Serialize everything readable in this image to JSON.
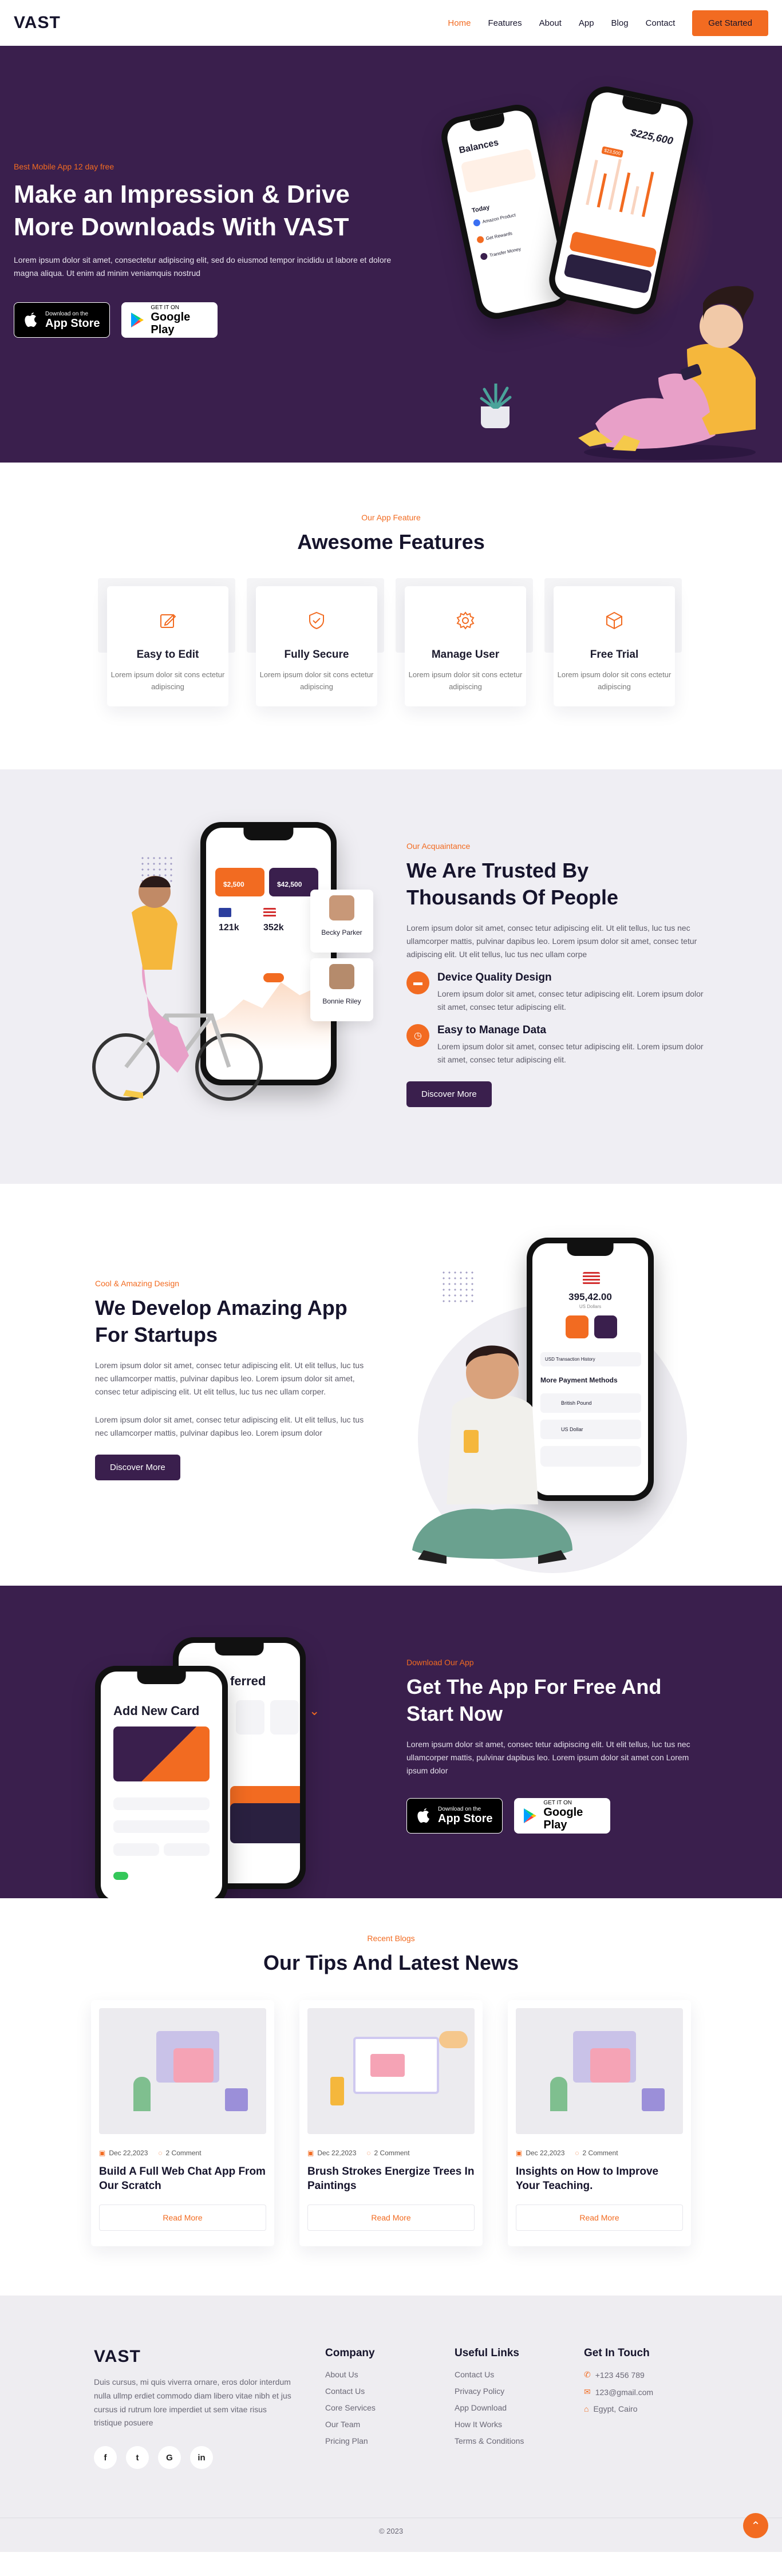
{
  "header": {
    "logo": "VAST",
    "nav": [
      "Home",
      "Features",
      "About",
      "App",
      "Blog",
      "Contact"
    ],
    "cta": "Get Started"
  },
  "hero": {
    "eyebrow": "Best Mobile App 12 day free",
    "title": "Make an Impression & Drive More Downloads With VAST",
    "text": "Lorem ipsum dolor sit amet, consectetur adipiscing elit, sed do eiusmod tempor incididu ut labore et dolore magna aliqua. Ut enim ad minim veniamquis nostrud",
    "phone_left": {
      "title": "Balances",
      "section": "Today",
      "items": [
        "Amazon Product",
        "Get Rewards",
        "Transfer Money"
      ]
    },
    "phone_right": {
      "balance": "$225,600",
      "badge": "$23,500"
    }
  },
  "stores": {
    "apple_small": "Download on the",
    "apple_big": "App Store",
    "google_small": "GET IT ON",
    "google_big": "Google Play"
  },
  "features": {
    "eyebrow": "Our App Feature",
    "title": "Awesome Features",
    "items": [
      {
        "title": "Easy to Edit",
        "text": "Lorem ipsum dolor sit cons ectetur adipiscing",
        "icon": "edit-icon"
      },
      {
        "title": "Fully Secure",
        "text": "Lorem ipsum dolor sit cons ectetur adipiscing",
        "icon": "shield-icon"
      },
      {
        "title": "Manage User",
        "text": "Lorem ipsum dolor sit cons ectetur adipiscing",
        "icon": "gear-icon"
      },
      {
        "title": "Free Trial",
        "text": "Lorem ipsum dolor sit cons ectetur adipiscing",
        "icon": "box-icon"
      }
    ]
  },
  "trusted": {
    "eyebrow": "Our Acquaintance",
    "title": "We Are Trusted By Thousands Of People",
    "text": "Lorem ipsum dolor sit amet, consec tetur adipiscing elit. Ut elit tellus, luc tus nec ullamcorper mattis, pulvinar dapibus leo. Lorem ipsum dolor sit amet, consec tetur adipiscing elit. Ut elit tellus, luc tus nec ullam corpe",
    "points": [
      {
        "title": "Device Quality Design",
        "text": "Lorem ipsum dolor sit amet, consec tetur adipiscing elit. Lorem ipsum dolor sit amet, consec tetur adipiscing elit."
      },
      {
        "title": "Easy to Manage Data",
        "text": "Lorem ipsum dolor sit amet, consec tetur adipiscing elit. Lorem ipsum dolor sit amet, consec tetur adipiscing elit."
      }
    ],
    "button": "Discover More",
    "phone": {
      "card1": "$2,500",
      "card2": "$42,500",
      "stat1": "121k",
      "stat2": "352k",
      "person1": "Becky Parker",
      "person2": "Bonnie Riley"
    }
  },
  "develop": {
    "eyebrow": "Cool & Amazing Design",
    "title": "We Develop Amazing App For Startups",
    "text1": "Lorem ipsum dolor sit amet, consec tetur adipiscing elit. Ut elit tellus, luc tus nec ullamcorper mattis, pulvinar dapibus leo. Lorem ipsum dolor sit amet, consec tetur adipiscing elit. Ut elit tellus, luc tus nec ullam corper.",
    "text2": "Lorem ipsum dolor sit amet, consec tetur adipiscing elit. Ut elit tellus, luc tus nec ullamcorper mattis, pulvinar dapibus leo. Lorem ipsum dolor",
    "button": "Discover More",
    "phone": {
      "amount": "395,42.00",
      "sub": "US Dollars",
      "history": "USD Transaction History",
      "methods": "More Payment Methods",
      "m1": "British Pound",
      "m2": "US Dollar"
    }
  },
  "download": {
    "eyebrow": "Download Our App",
    "title": "Get The App For Free And Start Now",
    "text": "Lorem ipsum dolor sit amet, consec tetur adipiscing elit. Ut elit tellus, luc tus nec ullamcorper mattis, pulvinar dapibus leo. Lorem ipsum dolor sit amet con Lorem ipsum dolor",
    "phone_front": "Add New Card",
    "phone_back": "ferred"
  },
  "blogs": {
    "eyebrow": "Recent Blogs",
    "title": "Our Tips And Latest News",
    "read_more": "Read More",
    "items": [
      {
        "date": "Dec 22,2023",
        "comments": "2 Comment",
        "title": "Build A Full Web Chat App From Our Scratch"
      },
      {
        "date": "Dec 22,2023",
        "comments": "2 Comment",
        "title": "Brush Strokes Energize Trees In Paintings"
      },
      {
        "date": "Dec 22,2023",
        "comments": "2 Comment",
        "title": "Insights on How to Improve Your Teaching."
      }
    ]
  },
  "footer": {
    "logo": "VAST",
    "about": "Duis cursus, mi quis viverra ornare, eros dolor interdum nulla ullmp erdiet commodo diam libero vitae nibh et jus cursus id rutrum lore imperdiet ut sem vitae risus tristique posuere",
    "socials": [
      "f",
      "t",
      "G",
      "in"
    ],
    "company_title": "Company",
    "company": [
      "About Us",
      "Contact Us",
      "Core Services",
      "Our Team",
      "Pricing Plan"
    ],
    "links_title": "Useful Links",
    "links": [
      "Contact Us",
      "Privacy Policy",
      "App Download",
      "How It Works",
      "Terms & Conditions"
    ],
    "contact_title": "Get In Touch",
    "contact": [
      "+123 456 789",
      "123@gmail.com",
      "Egypt, Cairo"
    ],
    "copyright": "© 2023"
  },
  "colors": {
    "primary": "#3a1f4d",
    "accent": "#f26b21"
  }
}
